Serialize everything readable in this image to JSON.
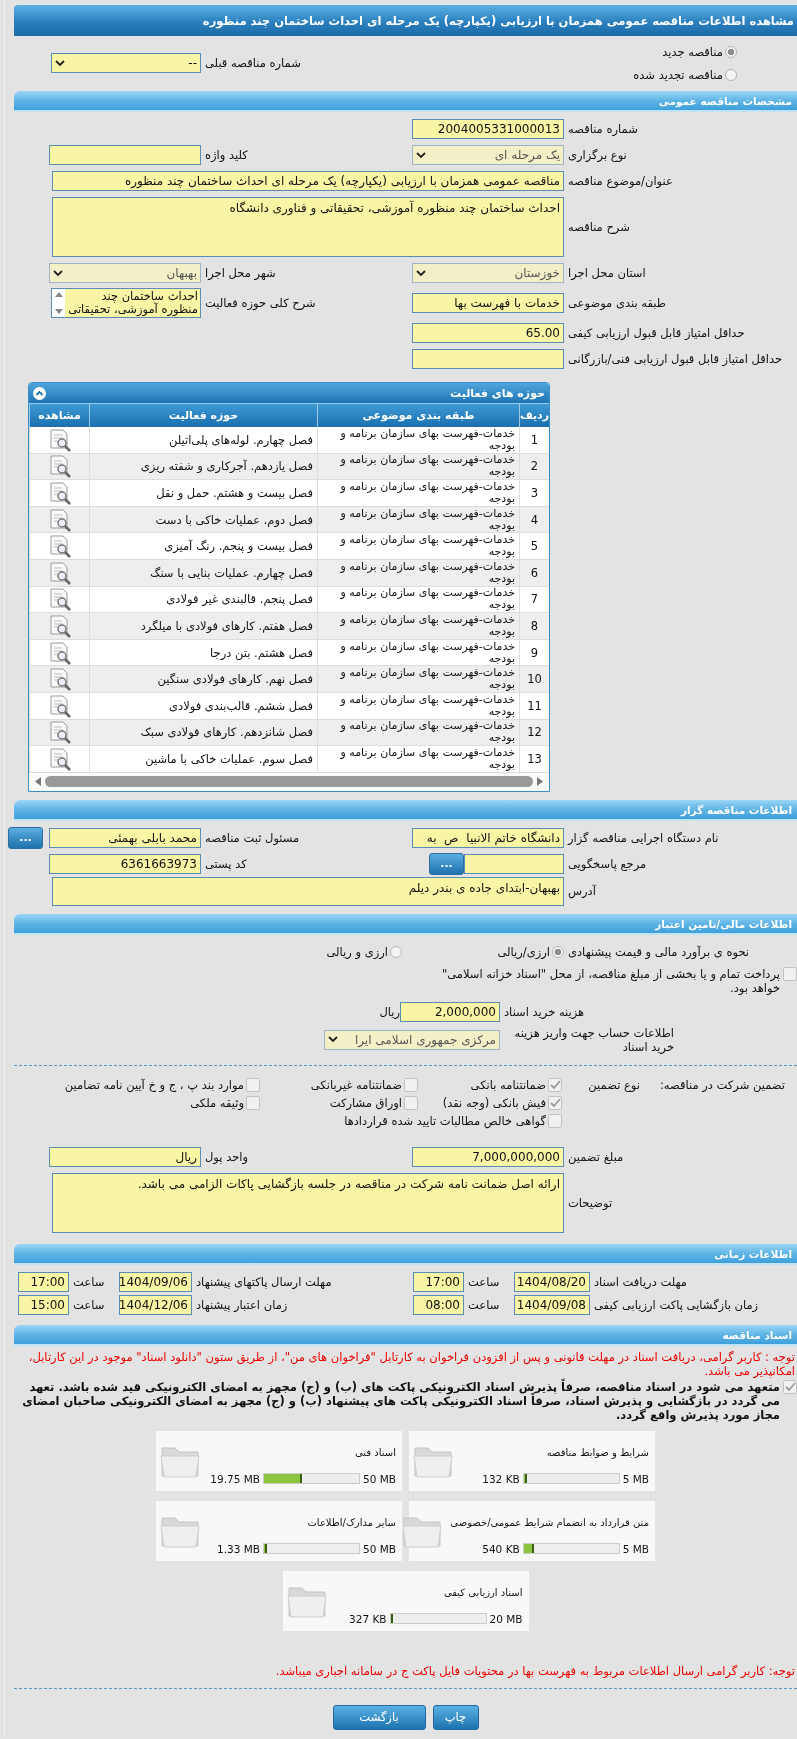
{
  "page_title": "مشاهده اطلاعات مناقصه عمومی همزمان با ارزیابی (یکپارچه) یک مرحله ای احداث ساختمان چند منظوره",
  "tender_type": {
    "options": [
      {
        "label": "مناقصه جدید",
        "selected": true
      },
      {
        "label": "مناقصه تجدید شده",
        "selected": false
      }
    ],
    "previous": {
      "label": "شماره مناقصه قبلی",
      "value": "--",
      "kind": "select"
    }
  },
  "general": {
    "title": "مشخصات مناقصه عمومی",
    "rows": [
      [
        {
          "label": "شماره مناقصه",
          "value": "2004005331000013",
          "kind": "text"
        }
      ],
      [
        {
          "label": "نوع برگزاری",
          "value": "یک مرحله ای",
          "kind": "select",
          "disabled": true
        },
        {
          "label": "کلید واژه",
          "kind": "text"
        }
      ],
      [
        {
          "label": "عنوان/موضوع مناقصه",
          "value": "مناقصه عمومی همزمان با ارزیابی (یکپارچه) یک مرحله ای احداث ساختمان چند منظوره",
          "kind": "line"
        }
      ],
      [
        {
          "label": "شرح مناقصه",
          "value": "احداث ساختمان چند منظوره آموزشی، تحقیقاتی و فناوری دانشگاه",
          "kind": "area"
        }
      ],
      [
        {
          "label": "استان محل اجرا",
          "value": "خوزستان",
          "kind": "select",
          "disabled": true
        },
        {
          "label": "شهر محل اجرا",
          "value": "بهبهان",
          "kind": "select",
          "disabled": true
        }
      ],
      [
        {
          "label": "طبقه بندی موضوعی",
          "value": "خدمات با فهرست بها",
          "kind": "text"
        },
        {
          "label": "شرح کلی حوزه فعالیت",
          "value": "احداث ساختمان چند منظوره آموزشی، تحقیقاتی",
          "kind": "list"
        }
      ],
      [
        {
          "label": "حداقل امتیاز قابل قبول ارزیابی کیفی",
          "value": "65.00",
          "kind": "text"
        }
      ],
      [
        {
          "label": "حداقل امتیاز قابل قبول ارزیابی فنی/بازرگانی",
          "kind": "text"
        }
      ]
    ]
  },
  "activity_areas": {
    "title": "حوزه های فعالیت",
    "columns": [
      "ردیف",
      "طبقه بندی موضوعی",
      "حوزه فعالیت",
      "مشاهده"
    ],
    "rows": [
      {
        "index": "1",
        "category": "خدمات-فهرست بهای سازمان برنامه و بودجه",
        "activity": "فصل چهارم. لوله‌های پلی‌اتیلن"
      },
      {
        "index": "2",
        "category": "خدمات-فهرست بهای سازمان برنامه و بودجه",
        "activity": "فصل یازدهم. آجرکاری و شفته ریزی"
      },
      {
        "index": "3",
        "category": "خدمات-فهرست بهای سازمان برنامه و بودجه",
        "activity": "فصل بیست و هشتم. حمل و نقل"
      },
      {
        "index": "4",
        "category": "خدمات-فهرست بهای سازمان برنامه و بودجه",
        "activity": "فصل دوم. عملیات خاکی با دست"
      },
      {
        "index": "5",
        "category": "خدمات-فهرست بهای سازمان برنامه و بودجه",
        "activity": "فصل بیست و پنجم. رنگ آمیزی"
      },
      {
        "index": "6",
        "category": "خدمات-فهرست بهای سازمان برنامه و بودجه",
        "activity": "فصل چهارم. عملیات بنایی با سنگ"
      },
      {
        "index": "7",
        "category": "خدمات-فهرست بهای سازمان برنامه و بودجه",
        "activity": "فصل پنجم. قالبندی غیر فولادی"
      },
      {
        "index": "8",
        "category": "خدمات-فهرست بهای سازمان برنامه و بودجه",
        "activity": "فصل هفتم. کارهای فولادی با میلگرد"
      },
      {
        "index": "9",
        "category": "خدمات-فهرست بهای سازمان برنامه و بودجه",
        "activity": "فصل هشتم. بتن درجا"
      },
      {
        "index": "10",
        "category": "خدمات-فهرست بهای سازمان برنامه و بودجه",
        "activity": "فصل نهم. کارهای فولادی سنگین"
      },
      {
        "index": "11",
        "category": "خدمات-فهرست بهای سازمان برنامه و بودجه",
        "activity": "فصل ششم. قالب‌بندی فولادی"
      },
      {
        "index": "12",
        "category": "خدمات-فهرست بهای سازمان برنامه و بودجه",
        "activity": "فصل شانزدهم. کارهای فولادی سبک"
      },
      {
        "index": "13",
        "category": "خدمات-فهرست بهای سازمان برنامه و بودجه",
        "activity": "فصل سوم. عملیات خاکی با ماشین"
      }
    ]
  },
  "employer": {
    "title": "اطلاعات مناقصه گزار",
    "rows": [
      [
        {
          "label": "نام دستگاه اجرایی مناقصه گزار",
          "value": "دانشگاه خاتم الانبیا  ص  به",
          "kind": "text"
        },
        {
          "label": "مسئول ثبت مناقصه",
          "value": "محمد بابلی بهمئی",
          "kind": "text",
          "button": "..."
        }
      ],
      [
        {
          "label": "مرجع پاسخگویی",
          "kind": "text",
          "button": "..."
        },
        {
          "label": "کد پستی",
          "value": "6361663973",
          "kind": "text"
        }
      ],
      [
        {
          "label": "آدرس",
          "value": "بهبهان-ابتدای جاده ی بندر دیلم",
          "kind": "note"
        }
      ]
    ]
  },
  "finance": {
    "title": "اطلاعات مالی/تامین اعتبار",
    "estimate": {
      "label": "نحوه ی برآورد مالی و قیمت پیشنهادی",
      "options": [
        {
          "label": "ارزی/ریالی",
          "selected": true
        },
        {
          "label": "ارزی و ریالی",
          "selected": false
        }
      ]
    },
    "treasury": {
      "text": "پرداخت تمام و یا بخشی از مبلغ مناقصه، از محل \"اسناد خزانه اسلامی\" خواهد بود.",
      "checked": false
    },
    "cost": {
      "label": "هزینه خرید اسناد",
      "value": "2,000,000",
      "unit": "ریال"
    },
    "account": {
      "label": "اطلاعات حساب جهت واریز هزینه خرید اسناد",
      "value": "مرکزی جمهوری اسلامی ایرا",
      "kind": "select",
      "disabled": true
    }
  },
  "guarantee": {
    "label": "تضمین شرکت در مناقصه:",
    "type_label": "نوع تضمین",
    "options": [
      {
        "label": "ضمانتنامه بانکی",
        "checked": true
      },
      {
        "label": "ضمانتنامه غیربانکی",
        "checked": false
      },
      {
        "label": "موارد بند پ ، ج و خ آیین نامه تضامین",
        "checked": false
      },
      {
        "label": "فیش بانکی (وجه نقد)",
        "checked": true
      },
      {
        "label": "اوراق مشارکت",
        "checked": false
      },
      {
        "label": "وثیقه ملکی",
        "checked": false
      },
      {
        "label": "گواهی خالص مطالبات تایید شده قراردادها",
        "checked": false
      }
    ],
    "rows": [
      [
        {
          "label": "مبلغ تضمین",
          "value": "7,000,000,000",
          "kind": "text"
        },
        {
          "label": "واحد پول",
          "value": "ریال",
          "kind": "text"
        }
      ],
      [
        {
          "label": "توضیحات",
          "value": "ارائه اصل ضمانت نامه شرکت در مناقصه در جلسه بازگشایی پاکات الزامی می باشد.",
          "kind": "area"
        }
      ]
    ]
  },
  "timing": {
    "title": "اطلاعات زمانی",
    "items": [
      {
        "label": "مهلت دریافت اسناد",
        "date": "1404/08/20",
        "time_label": "ساعت",
        "time": "17:00"
      },
      {
        "label": "مهلت ارسال پاکتهای پیشنهاد",
        "date": "1404/09/06",
        "time_label": "ساعت",
        "time": "17:00"
      },
      {
        "label": "زمان بازگشایی پاکت ارزیابی کیفی",
        "date": "1404/09/08",
        "time_label": "ساعت",
        "time": "08:00"
      },
      {
        "label": "زمان اعتبار پیشنهاد",
        "date": "1404/12/06",
        "time_label": "ساعت",
        "time": "15:00"
      }
    ]
  },
  "documents": {
    "title": "اسناد مناقصه",
    "notice": "توجه : کاربر گرامی، دریافت اسناد در مهلت قانونی و پس از افزودن فراخوان به کارتابل \"فراخوان های من\"، از طریق ستون \"دانلود اسناد\" موجود در این کارتابل، امکانپذیر می باشد.",
    "commitment": {
      "text": "متعهد می شود در اسناد مناقصه، صرفاً پذیرش اسناد الکترونیکی پاکت های (ب) و (ج) مجهز به امضای الکترونیکی قید شده باشد. تعهد می گردد در بازگشایی و پذیرش اسناد، صرفاً اسناد الکترونیکی پاکت های پیشنهاد (ب) و (ج) مجهز به امضای الکترونیکی صاحبان امضای مجاز مورد پذیرش واقع گردد.",
      "checked": true
    },
    "files": [
      {
        "name": "شرایط و ضوابط مناقصه",
        "max": "5 MB",
        "used": "132 KB",
        "level": 0.03
      },
      {
        "name": "اسناد فنی",
        "max": "50 MB",
        "used": "19.75 MB",
        "level": 0.4
      },
      {
        "name": "متن قرارداد به انضمام شرایط عمومی/خصوصی",
        "max": "5 MB",
        "used": "540 KB",
        "level": 0.11
      },
      {
        "name": "سایر مدارک/اطلاعات",
        "max": "50 MB",
        "used": "1.33 MB",
        "level": 0.03
      },
      {
        "name": "اسناد ارزیابی کیفی",
        "max": "20 MB",
        "used": "327 KB",
        "level": 0.02
      }
    ],
    "footer_notice": "توجه: کاربر گرامی ارسال اطلاعات مربوط به فهرست بها در محتویات فایل پاکت ج در سامانه اجباری میباشد."
  },
  "buttons": [
    "چاپ",
    "بازگشت"
  ]
}
